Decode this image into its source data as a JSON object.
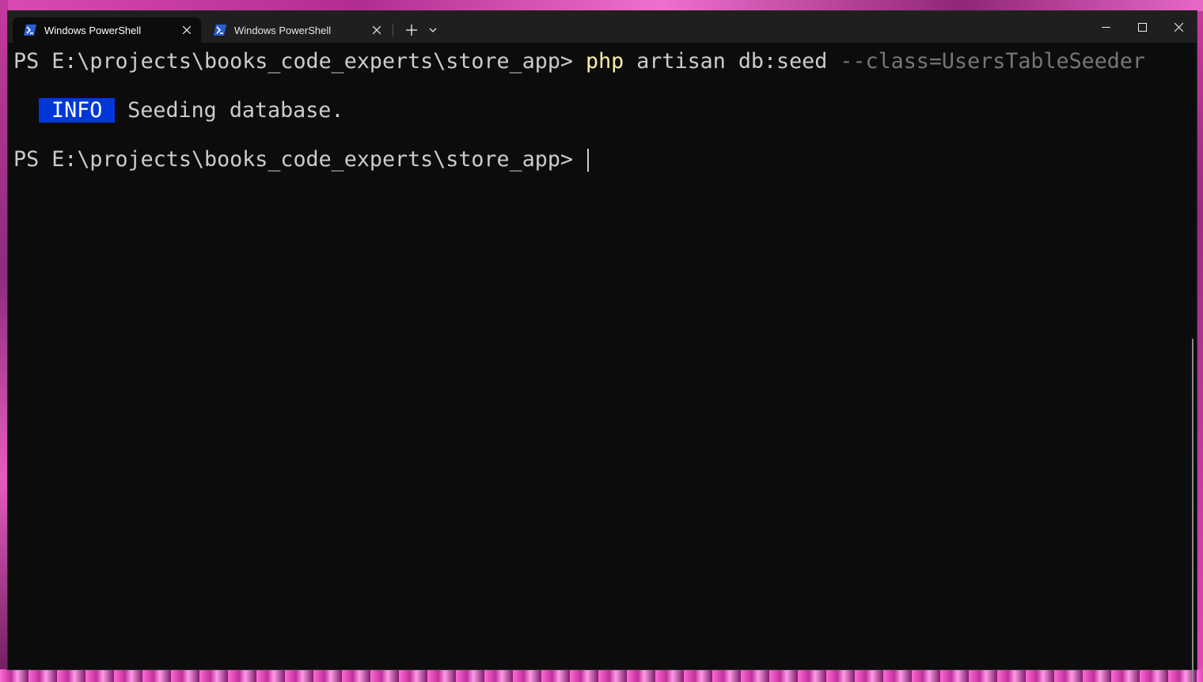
{
  "window": {
    "tabs": [
      {
        "title": "Windows PowerShell",
        "active": true,
        "icon": "powershell-icon"
      },
      {
        "title": "Windows PowerShell",
        "active": false,
        "icon": "powershell-icon"
      }
    ],
    "controls": {
      "minimize_icon": "minimize-icon",
      "maximize_icon": "maximize-icon",
      "close_icon": "close-icon"
    },
    "new_tab_icon": "plus-icon",
    "dropdown_icon": "chevron-down-icon"
  },
  "terminal": {
    "colors": {
      "background": "#0c0c0c",
      "foreground": "#cccccc",
      "command": "#f9f1a5",
      "parameter": "#767676",
      "info_badge": "#0037da"
    },
    "lines": [
      {
        "prompt": "PS E:\\projects\\books_code_experts\\store_app> ",
        "command": "php",
        "args": " artisan db:seed ",
        "param": "--class=UsersTableSeeder"
      },
      {
        "badge": "INFO",
        "message": "Seeding database."
      },
      {
        "prompt": "PS E:\\projects\\books_code_experts\\store_app> "
      }
    ]
  }
}
